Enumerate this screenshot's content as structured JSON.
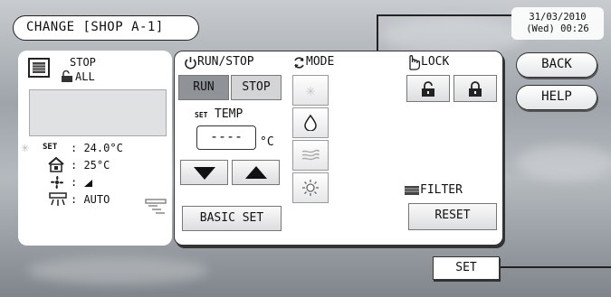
{
  "header": {
    "title": "CHANGE [SHOP A-1]",
    "date": "31/03/2010",
    "time": "(Wed) 00:26"
  },
  "nav": {
    "back_label": "BACK",
    "help_label": "HELP"
  },
  "status": {
    "run_state": "STOP",
    "group": "ALL",
    "set_temp": ": 24.0°C",
    "room_temp": ": 25°C",
    "fan_speed": ":",
    "louver": ": AUTO"
  },
  "controls": {
    "run_stop_title": "RUN/STOP",
    "run_label": "RUN",
    "stop_label": "STOP",
    "temp_title": "TEMP",
    "temp_value": "----",
    "temp_unit": "°C",
    "basic_set_label": "BASIC SET",
    "mode_title": "MODE",
    "lock_title": "LOCK",
    "filter_title": "FILTER",
    "reset_label": "RESET",
    "set_label": "SET"
  },
  "icons": {
    "unit": "indoor-unit-icon",
    "lock_small": "lock-icon",
    "cool": "snowflake-icon",
    "dry": "droplet-icon",
    "fan": "fan-icon",
    "heat": "sun-icon"
  }
}
